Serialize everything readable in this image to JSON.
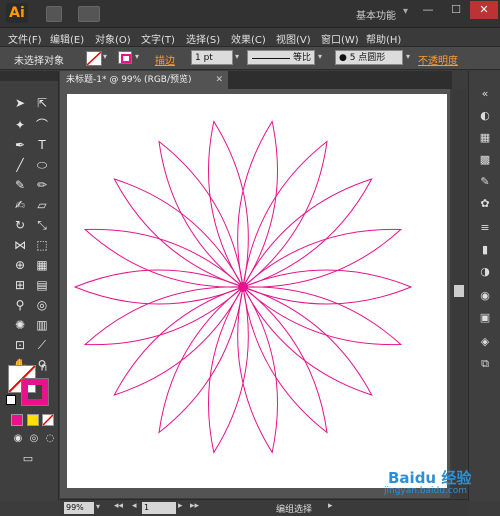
{
  "app": {
    "logo": "Ai",
    "workspace": "基本功能"
  },
  "menu": [
    "文件(F)",
    "编辑(E)",
    "对象(O)",
    "文字(T)",
    "选择(S)",
    "效果(C)",
    "视图(V)",
    "窗口(W)",
    "帮助(H)"
  ],
  "control": {
    "selection_status": "未选择对象",
    "stroke_label": "描边",
    "stroke_weight": "1 pt",
    "profile_label": "等比",
    "brush_label": "5 点圆形",
    "opacity_link": "不透明度"
  },
  "document": {
    "tab_title": "未标题-1* @ 99% (RGB/预览)"
  },
  "status": {
    "zoom": "99%",
    "page": "1",
    "message": "编组选择"
  },
  "watermark": {
    "text": "Baidu 经验",
    "url": "jingyan.baidu.com"
  },
  "colors": {
    "stroke": "#e8128c",
    "accent_orange": "#ff9b2e"
  },
  "artwork": {
    "petals": 18
  }
}
